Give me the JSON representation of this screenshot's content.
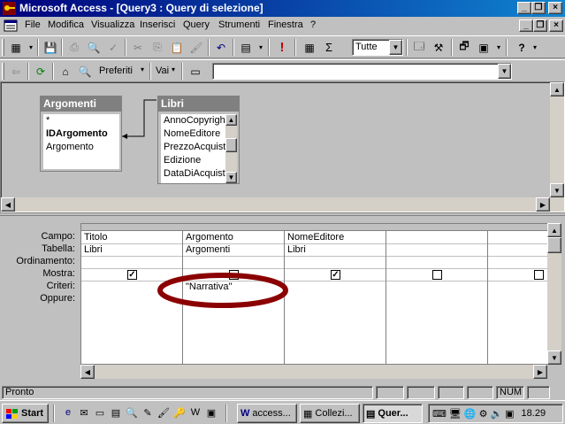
{
  "window": {
    "title": "Microsoft Access - [Query3 : Query di selezione]"
  },
  "menu": [
    "File",
    "Modifica",
    "Visualizza",
    "Inserisci",
    "Query",
    "Strumenti",
    "Finestra",
    "?"
  ],
  "toolbar": {
    "query_type_value": "Tutte"
  },
  "webbar": {
    "favorites_label": "Preferiti",
    "go_label": "Vai",
    "address_value": ""
  },
  "tables": [
    {
      "name": "Argomenti",
      "fields": [
        "*",
        "IDArgomento",
        "Argomento"
      ]
    },
    {
      "name": "Libri",
      "fields": [
        "AnnoCopyright",
        "NomeEditore",
        "PrezzoAcquisto",
        "Edizione",
        "DataDiAcquisto"
      ]
    }
  ],
  "grid": {
    "row_labels": [
      "Campo:",
      "Tabella:",
      "Ordinamento:",
      "Mostra:",
      "Criteri:",
      "Oppure:"
    ],
    "columns": [
      {
        "campo": "Titolo",
        "tabella": "Libri",
        "ordinamento": "",
        "mostra": true,
        "criteri": ""
      },
      {
        "campo": "Argomento",
        "tabella": "Argomenti",
        "ordinamento": "",
        "mostra": false,
        "criteri": "\"Narrativa\""
      },
      {
        "campo": "NomeEditore",
        "tabella": "Libri",
        "ordinamento": "",
        "mostra": true,
        "criteri": ""
      },
      {
        "campo": "",
        "tabella": "",
        "ordinamento": "",
        "mostra": false,
        "criteri": ""
      },
      {
        "campo": "",
        "tabella": "",
        "ordinamento": "",
        "mostra": false,
        "criteri": ""
      }
    ]
  },
  "status": {
    "text": "Pronto",
    "num": "NUM"
  },
  "taskbar": {
    "start": "Start",
    "tasks": [
      "access...",
      "Collezi...",
      "Quer..."
    ],
    "clock": "18.29"
  },
  "colors": {
    "titlebar_start": "#00007b",
    "titlebar_end": "#1084d0",
    "annotation_ellipse": "#8b0000"
  }
}
